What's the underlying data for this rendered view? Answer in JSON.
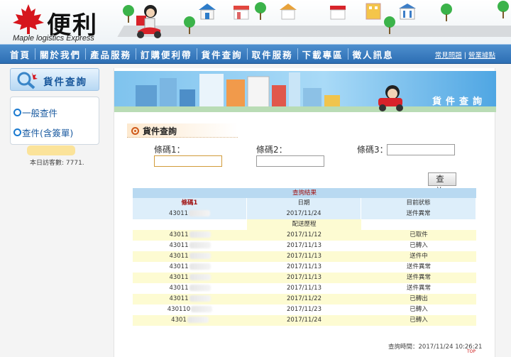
{
  "logo": {
    "name_cn": "便利帶",
    "name_en": "Maple logistics Express"
  },
  "nav": {
    "items": [
      "首頁",
      "關於我們",
      "產品服務",
      "訂購便利帶",
      "貨件查詢",
      "取件服務",
      "下載專區",
      "徵人訊息"
    ],
    "faq": "常見問題",
    "branches": "營業據點"
  },
  "sidebar": {
    "title": "貨件查詢",
    "items": [
      "一般查件",
      "查件(含簽單)"
    ],
    "visitors": "本日訪客數: 7771."
  },
  "main": {
    "banner_title": "貨件查詢",
    "section_title": "貨件查詢",
    "barcode_labels": [
      "條碼1：",
      "條碼2：",
      "條碼3："
    ],
    "barcode_values": [
      "",
      "",
      ""
    ],
    "query_button": "查 詢"
  },
  "result": {
    "title": "查詢結果",
    "headers": [
      "條碼1",
      "日期",
      "目前狀態"
    ],
    "summary": {
      "barcode": "43011",
      "date": "2017/11/24",
      "status": "送件異常"
    },
    "history_label": "配送歷程",
    "history": [
      {
        "barcode": "43011",
        "date": "2017/11/12",
        "status": "已取件"
      },
      {
        "barcode": "43011",
        "date": "2017/11/13",
        "status": "已轉入"
      },
      {
        "barcode": "43011",
        "date": "2017/11/13",
        "status": "送件中"
      },
      {
        "barcode": "43011",
        "date": "2017/11/13",
        "status": "送件異常"
      },
      {
        "barcode": "43011",
        "date": "2017/11/13",
        "status": "送件異常"
      },
      {
        "barcode": "43011",
        "date": "2017/11/13",
        "status": "送件異常"
      },
      {
        "barcode": "43011",
        "date": "2017/11/22",
        "status": "已轉出"
      },
      {
        "barcode": "430110",
        "date": "2017/11/23",
        "status": "已轉入"
      },
      {
        "barcode": "4301",
        "date": "2017/11/24",
        "status": "已轉入"
      }
    ],
    "query_time": "查詢時間：2017/11/24 10:26:21"
  },
  "top_link": "TOP",
  "colors": {
    "nav": "#2d6eb4",
    "accent_red": "#a01010",
    "row_blue": "#ddeefa",
    "row_yellow": "#fdfbd2"
  }
}
